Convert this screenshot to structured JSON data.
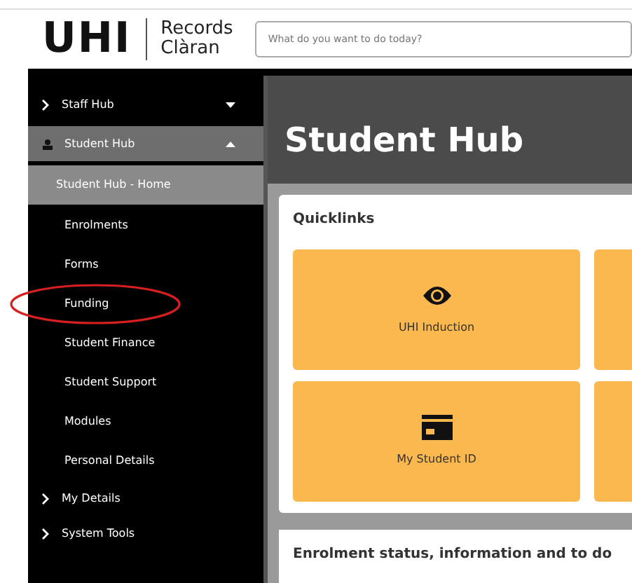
{
  "header": {
    "logo": "UHI",
    "app_name": [
      "Records",
      "Clàran"
    ],
    "search": {
      "placeholder": "What do you want to do today?"
    }
  },
  "sidebar": {
    "items": [
      {
        "label": "Staff Hub",
        "kind": "section",
        "expanded": false,
        "selected": false
      },
      {
        "label": "Student Hub",
        "kind": "profile",
        "expanded": true,
        "selected": true,
        "children": [
          {
            "label": "Student Hub - Home",
            "selected": true
          },
          {
            "label": "Enrolments",
            "selected": false
          },
          {
            "label": "Forms",
            "selected": false
          },
          {
            "label": "Funding",
            "selected": false,
            "circled": true
          },
          {
            "label": "Student Finance",
            "selected": false
          },
          {
            "label": "Student Support",
            "selected": false
          },
          {
            "label": "Modules",
            "selected": false
          },
          {
            "label": "Personal Details",
            "selected": false
          }
        ]
      },
      {
        "label": "My Details",
        "kind": "link",
        "selected": false
      },
      {
        "label": "System Tools",
        "kind": "link",
        "selected": false
      }
    ]
  },
  "page_title": "Student Hub",
  "quicklinks": {
    "title": "Quicklinks",
    "tiles": [
      {
        "label": "UHI Induction",
        "kind": "eye"
      },
      {
        "kind": "blank"
      },
      {
        "label": "My Student ID",
        "kind": "card"
      },
      {
        "kind": "blank"
      }
    ]
  },
  "enrolment_card": {
    "title": "Enrolment status, information and to do"
  }
}
